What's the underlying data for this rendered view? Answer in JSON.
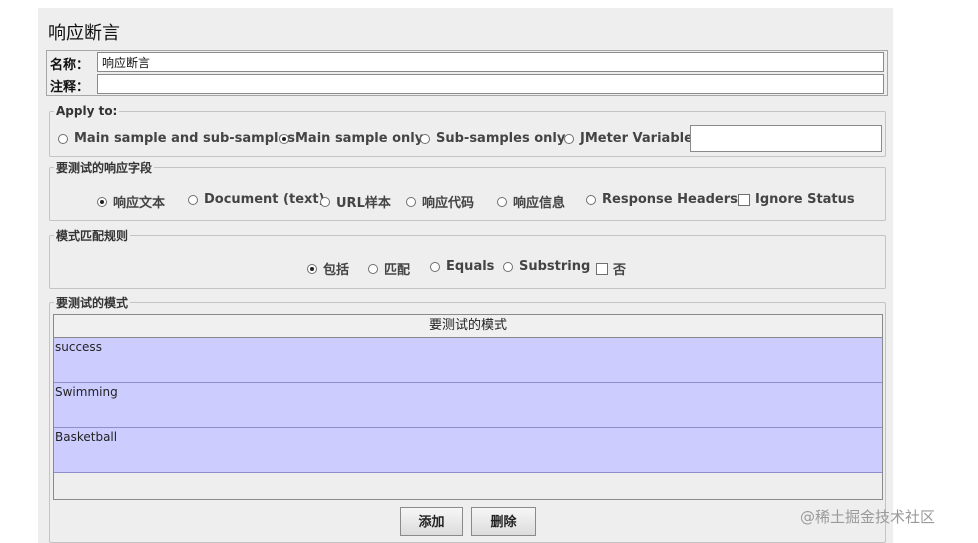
{
  "page_title": "响应断言",
  "name_field": {
    "label": "名称：",
    "value": "响应断言"
  },
  "comment_field": {
    "label": "注释：",
    "value": ""
  },
  "apply_to": {
    "legend": "Apply to:",
    "options": [
      {
        "label": "Main sample and sub-samples",
        "selected": false
      },
      {
        "label": "Main sample only",
        "selected": true
      },
      {
        "label": "Sub-samples only",
        "selected": false
      },
      {
        "label": "JMeter Variable",
        "selected": false
      }
    ],
    "variable_value": ""
  },
  "response_field": {
    "legend": "要测试的响应字段",
    "options": [
      {
        "label": "响应文本",
        "selected": true
      },
      {
        "label": "Document (text)",
        "selected": false
      },
      {
        "label": "URL样本",
        "selected": false
      },
      {
        "label": "响应代码",
        "selected": false
      },
      {
        "label": "响应信息",
        "selected": false
      },
      {
        "label": "Response Headers",
        "selected": false
      }
    ],
    "ignore_status": {
      "label": "Ignore Status",
      "checked": false
    }
  },
  "pattern_rules": {
    "legend": "模式匹配规则",
    "options": [
      {
        "label": "包括",
        "selected": true
      },
      {
        "label": "匹配",
        "selected": false
      },
      {
        "label": "Equals",
        "selected": false
      },
      {
        "label": "Substring",
        "selected": false
      }
    ],
    "negate": {
      "label": "否",
      "checked": false
    }
  },
  "patterns": {
    "legend": "要测试的模式",
    "column_header": "要测试的模式",
    "rows": [
      "success",
      "Swimming",
      "Basketball"
    ]
  },
  "buttons": {
    "add": "添加",
    "delete": "删除"
  },
  "watermark": "@稀土掘金技术社区",
  "colors": {
    "panel_bg": "#eeeeee",
    "row_bg": "#ccccff"
  }
}
